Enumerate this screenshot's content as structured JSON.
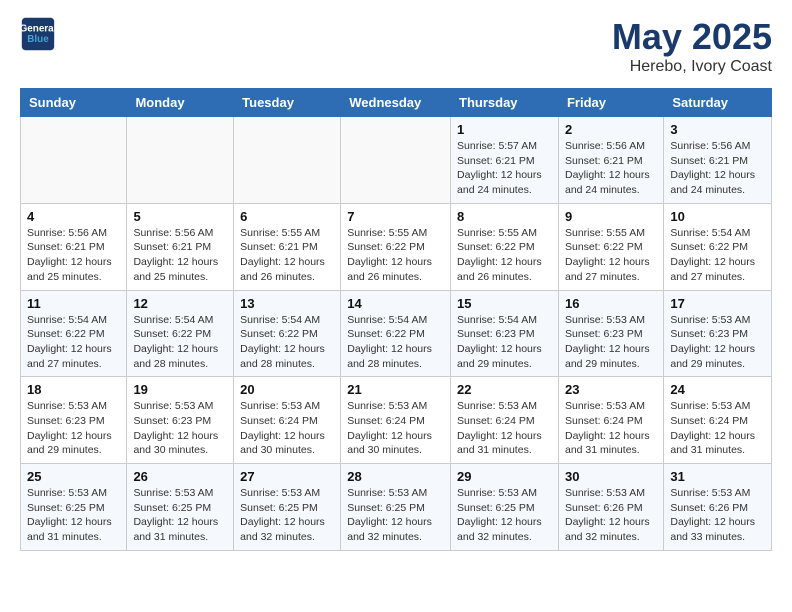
{
  "header": {
    "logo_line1": "General",
    "logo_line2": "Blue",
    "title": "May 2025",
    "subtitle": "Herebo, Ivory Coast"
  },
  "weekdays": [
    "Sunday",
    "Monday",
    "Tuesday",
    "Wednesday",
    "Thursday",
    "Friday",
    "Saturday"
  ],
  "weeks": [
    [
      {
        "day": "",
        "info": ""
      },
      {
        "day": "",
        "info": ""
      },
      {
        "day": "",
        "info": ""
      },
      {
        "day": "",
        "info": ""
      },
      {
        "day": "1",
        "info": "Sunrise: 5:57 AM\nSunset: 6:21 PM\nDaylight: 12 hours and 24 minutes."
      },
      {
        "day": "2",
        "info": "Sunrise: 5:56 AM\nSunset: 6:21 PM\nDaylight: 12 hours and 24 minutes."
      },
      {
        "day": "3",
        "info": "Sunrise: 5:56 AM\nSunset: 6:21 PM\nDaylight: 12 hours and 24 minutes."
      }
    ],
    [
      {
        "day": "4",
        "info": "Sunrise: 5:56 AM\nSunset: 6:21 PM\nDaylight: 12 hours and 25 minutes."
      },
      {
        "day": "5",
        "info": "Sunrise: 5:56 AM\nSunset: 6:21 PM\nDaylight: 12 hours and 25 minutes."
      },
      {
        "day": "6",
        "info": "Sunrise: 5:55 AM\nSunset: 6:21 PM\nDaylight: 12 hours and 26 minutes."
      },
      {
        "day": "7",
        "info": "Sunrise: 5:55 AM\nSunset: 6:22 PM\nDaylight: 12 hours and 26 minutes."
      },
      {
        "day": "8",
        "info": "Sunrise: 5:55 AM\nSunset: 6:22 PM\nDaylight: 12 hours and 26 minutes."
      },
      {
        "day": "9",
        "info": "Sunrise: 5:55 AM\nSunset: 6:22 PM\nDaylight: 12 hours and 27 minutes."
      },
      {
        "day": "10",
        "info": "Sunrise: 5:54 AM\nSunset: 6:22 PM\nDaylight: 12 hours and 27 minutes."
      }
    ],
    [
      {
        "day": "11",
        "info": "Sunrise: 5:54 AM\nSunset: 6:22 PM\nDaylight: 12 hours and 27 minutes."
      },
      {
        "day": "12",
        "info": "Sunrise: 5:54 AM\nSunset: 6:22 PM\nDaylight: 12 hours and 28 minutes."
      },
      {
        "day": "13",
        "info": "Sunrise: 5:54 AM\nSunset: 6:22 PM\nDaylight: 12 hours and 28 minutes."
      },
      {
        "day": "14",
        "info": "Sunrise: 5:54 AM\nSunset: 6:22 PM\nDaylight: 12 hours and 28 minutes."
      },
      {
        "day": "15",
        "info": "Sunrise: 5:54 AM\nSunset: 6:23 PM\nDaylight: 12 hours and 29 minutes."
      },
      {
        "day": "16",
        "info": "Sunrise: 5:53 AM\nSunset: 6:23 PM\nDaylight: 12 hours and 29 minutes."
      },
      {
        "day": "17",
        "info": "Sunrise: 5:53 AM\nSunset: 6:23 PM\nDaylight: 12 hours and 29 minutes."
      }
    ],
    [
      {
        "day": "18",
        "info": "Sunrise: 5:53 AM\nSunset: 6:23 PM\nDaylight: 12 hours and 29 minutes."
      },
      {
        "day": "19",
        "info": "Sunrise: 5:53 AM\nSunset: 6:23 PM\nDaylight: 12 hours and 30 minutes."
      },
      {
        "day": "20",
        "info": "Sunrise: 5:53 AM\nSunset: 6:24 PM\nDaylight: 12 hours and 30 minutes."
      },
      {
        "day": "21",
        "info": "Sunrise: 5:53 AM\nSunset: 6:24 PM\nDaylight: 12 hours and 30 minutes."
      },
      {
        "day": "22",
        "info": "Sunrise: 5:53 AM\nSunset: 6:24 PM\nDaylight: 12 hours and 31 minutes."
      },
      {
        "day": "23",
        "info": "Sunrise: 5:53 AM\nSunset: 6:24 PM\nDaylight: 12 hours and 31 minutes."
      },
      {
        "day": "24",
        "info": "Sunrise: 5:53 AM\nSunset: 6:24 PM\nDaylight: 12 hours and 31 minutes."
      }
    ],
    [
      {
        "day": "25",
        "info": "Sunrise: 5:53 AM\nSunset: 6:25 PM\nDaylight: 12 hours and 31 minutes."
      },
      {
        "day": "26",
        "info": "Sunrise: 5:53 AM\nSunset: 6:25 PM\nDaylight: 12 hours and 31 minutes."
      },
      {
        "day": "27",
        "info": "Sunrise: 5:53 AM\nSunset: 6:25 PM\nDaylight: 12 hours and 32 minutes."
      },
      {
        "day": "28",
        "info": "Sunrise: 5:53 AM\nSunset: 6:25 PM\nDaylight: 12 hours and 32 minutes."
      },
      {
        "day": "29",
        "info": "Sunrise: 5:53 AM\nSunset: 6:25 PM\nDaylight: 12 hours and 32 minutes."
      },
      {
        "day": "30",
        "info": "Sunrise: 5:53 AM\nSunset: 6:26 PM\nDaylight: 12 hours and 32 minutes."
      },
      {
        "day": "31",
        "info": "Sunrise: 5:53 AM\nSunset: 6:26 PM\nDaylight: 12 hours and 33 minutes."
      }
    ]
  ]
}
